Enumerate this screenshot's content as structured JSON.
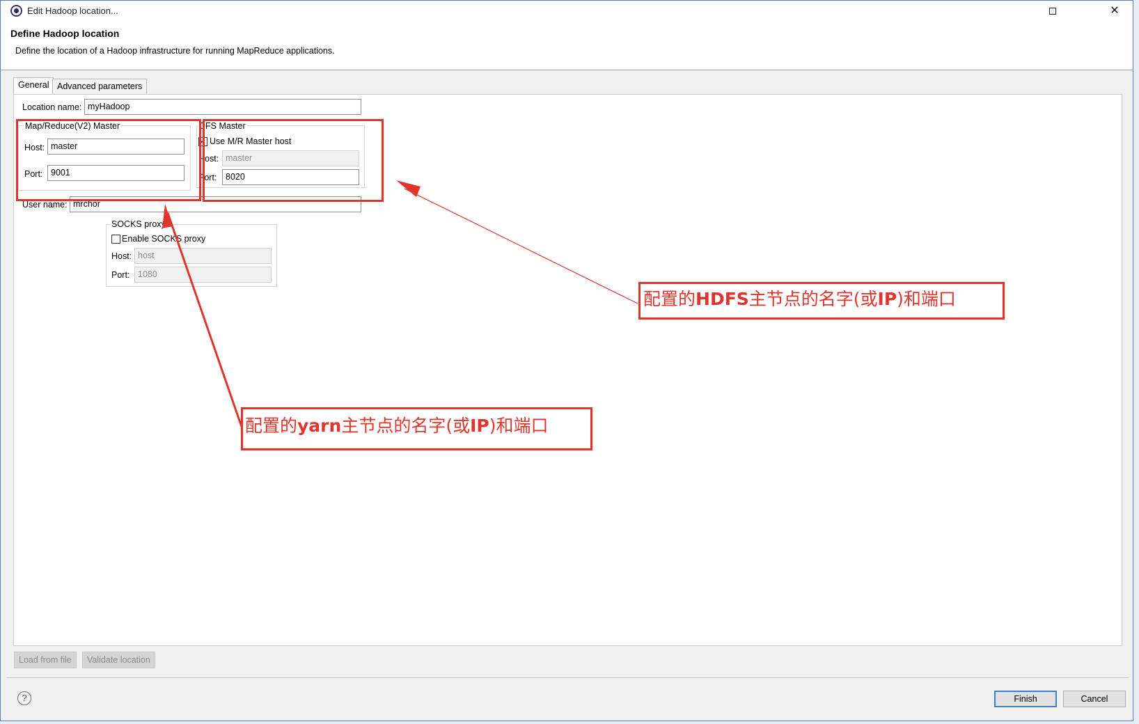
{
  "window": {
    "title": "Edit Hadoop location..."
  },
  "header": {
    "title": "Define Hadoop location",
    "description": "Define the location of a Hadoop infrastructure for running MapReduce applications."
  },
  "tabs": [
    {
      "label": "General",
      "active": true
    },
    {
      "label": "Advanced parameters",
      "active": false
    }
  ],
  "general": {
    "location_name_label": "Location name:",
    "location_name_value": "myHadoop",
    "mr_master": {
      "title": "Map/Reduce(V2) Master",
      "host_label": "Host:",
      "host_value": "master",
      "port_label": "Port:",
      "port_value": "9001"
    },
    "dfs_master": {
      "title": "DFS Master",
      "use_mr_host_label": "Use M/R Master host",
      "use_mr_host_checked": true,
      "host_label": "Host:",
      "host_value": "master",
      "port_label": "Port:",
      "port_value": "8020"
    },
    "user_name_label": "User name:",
    "user_name_value": "mrchor",
    "socks": {
      "title": "SOCKS proxy",
      "enable_label": "Enable SOCKS proxy",
      "enable_checked": false,
      "host_label": "Host:",
      "host_value": "host",
      "port_label": "Port:",
      "port_value": "1080"
    }
  },
  "annotations": {
    "hdfs_prefix": "配置的",
    "hdfs_bold": "HDFS",
    "hdfs_suffix": "主节点的名字(或",
    "hdfs_ip": "IP",
    "hdfs_end": ")和端口",
    "yarn_prefix": "配置的",
    "yarn_bold": "yarn",
    "yarn_suffix": "主节点的名字(或",
    "yarn_ip": "IP",
    "yarn_end": ")和端口",
    "color": "#e0352d"
  },
  "bottom_buttons": {
    "load_from_file": "Load from file",
    "validate_location": "Validate location"
  },
  "footer": {
    "help": "?",
    "finish": "Finish",
    "cancel": "Cancel"
  }
}
